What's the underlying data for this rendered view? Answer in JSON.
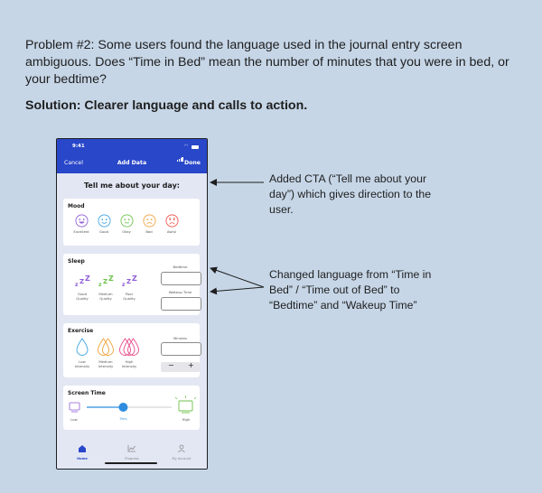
{
  "problem_text": "Problem #2: Some users found the language used in the journal entry screen ambiguous. Does “Time in Bed” mean the number of minutes that you were in bed, or your bedtime?",
  "solution_text": "Solution: Clearer language and calls to action.",
  "phone": {
    "status_time": "9:41",
    "nav": {
      "cancel": "Cancel",
      "title": "Add Data",
      "done": "Done"
    },
    "cta": "Tell me about your day:",
    "mood": {
      "title": "Mood",
      "options": [
        {
          "label": "Excellent",
          "color": "#8e5bd6",
          "icon": "very-happy-face-icon"
        },
        {
          "label": "Good",
          "color": "#3aa3e0",
          "icon": "happy-face-icon"
        },
        {
          "label": "Okay",
          "color": "#6cc24a",
          "icon": "neutral-face-icon"
        },
        {
          "label": "Bad",
          "color": "#f0a13b",
          "icon": "sad-face-icon"
        },
        {
          "label": "Awful",
          "color": "#e9504a",
          "icon": "angry-face-icon"
        }
      ]
    },
    "sleep": {
      "title": "Sleep",
      "options": [
        {
          "line1": "Good",
          "line2": "Quality",
          "color": "#8e5bd6"
        },
        {
          "line1": "Medium",
          "line2": "Quality",
          "color": "#6cc24a"
        },
        {
          "line1": "Poor",
          "line2": "Quality",
          "color": "#8e5bd6"
        }
      ],
      "bedtime_label": "Bedtime",
      "wakeup_label": "Wakeup Time"
    },
    "exercise": {
      "title": "Exercise",
      "options": [
        {
          "line1": "Low",
          "line2": "Intensity",
          "color": "#3aa3e0"
        },
        {
          "line1": "Medium",
          "line2": "Intensity",
          "color": "#f0a13b"
        },
        {
          "line1": "High",
          "line2": "Intensity",
          "color": "#e94b8a"
        }
      ],
      "minutes_label": "Minutes",
      "minus": "−",
      "plus": "+"
    },
    "screen_time": {
      "title": "Screen Time",
      "low_label": "Low",
      "high_label": "High",
      "value_label": "3hrs",
      "slider_value": 0.43
    },
    "tabs": [
      {
        "label": "Home",
        "icon": "home-icon",
        "active": true
      },
      {
        "label": "Progress",
        "icon": "chart-icon",
        "active": false
      },
      {
        "label": "My Account",
        "icon": "person-icon",
        "active": false
      }
    ]
  },
  "annotations": {
    "note1": "Added CTA (“Tell me about your day”) which gives direction to the user.",
    "note2": "Changed language from “Time in Bed” / “Time out of Bed” to “Bedtime” and “Wakeup Time”"
  },
  "colors": {
    "accent": "#2947c9",
    "background": "#c6d6e7",
    "phone_bg": "#e3e7f4"
  }
}
